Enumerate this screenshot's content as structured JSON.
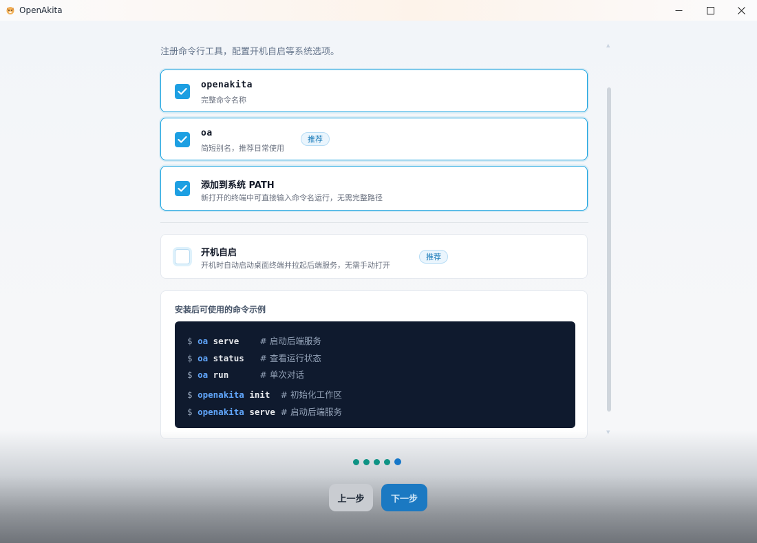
{
  "window": {
    "title": "OpenAkita"
  },
  "intro": "注册命令行工具，配置开机自启等系统选项。",
  "options": [
    {
      "title": "openakita",
      "desc": "完整命令名称",
      "checked": true
    },
    {
      "title": "oa",
      "desc": "简短别名，推荐日常使用",
      "checked": true,
      "badge": "推荐"
    },
    {
      "title": "添加到系统 PATH",
      "desc": "新打开的终端中可直接输入命令名运行，无需完整路径",
      "checked": true
    },
    {
      "title": "开机自启",
      "desc": "开机时自动启动桌面终端并拉起后端服务，无需手动打开",
      "checked": false,
      "badge": "推荐"
    }
  ],
  "examples": {
    "title": "安装后可使用的命令示例",
    "lines": [
      {
        "prompt": "$",
        "cmd": "oa",
        "arg": "serve",
        "comment": "# 启动后端服务"
      },
      {
        "prompt": "$",
        "cmd": "oa",
        "arg": "status",
        "comment": "# 查看运行状态"
      },
      {
        "prompt": "$",
        "cmd": "oa",
        "arg": "run",
        "comment": "# 单次对话"
      },
      {
        "prompt": "$",
        "cmd": "openakita",
        "arg": "init",
        "comment": "# 初始化工作区"
      },
      {
        "prompt": "$",
        "cmd": "openakita",
        "arg": "serve",
        "comment": "# 启动后端服务"
      }
    ]
  },
  "wizard": {
    "total_steps": 5,
    "current_step": 5
  },
  "buttons": {
    "prev": "上一步",
    "next": "下一步"
  },
  "colors": {
    "accent": "#1d9fe2",
    "code_bg": "#0f1a2e",
    "step_dot": "#0e9384",
    "step_active": "#1677c9"
  }
}
